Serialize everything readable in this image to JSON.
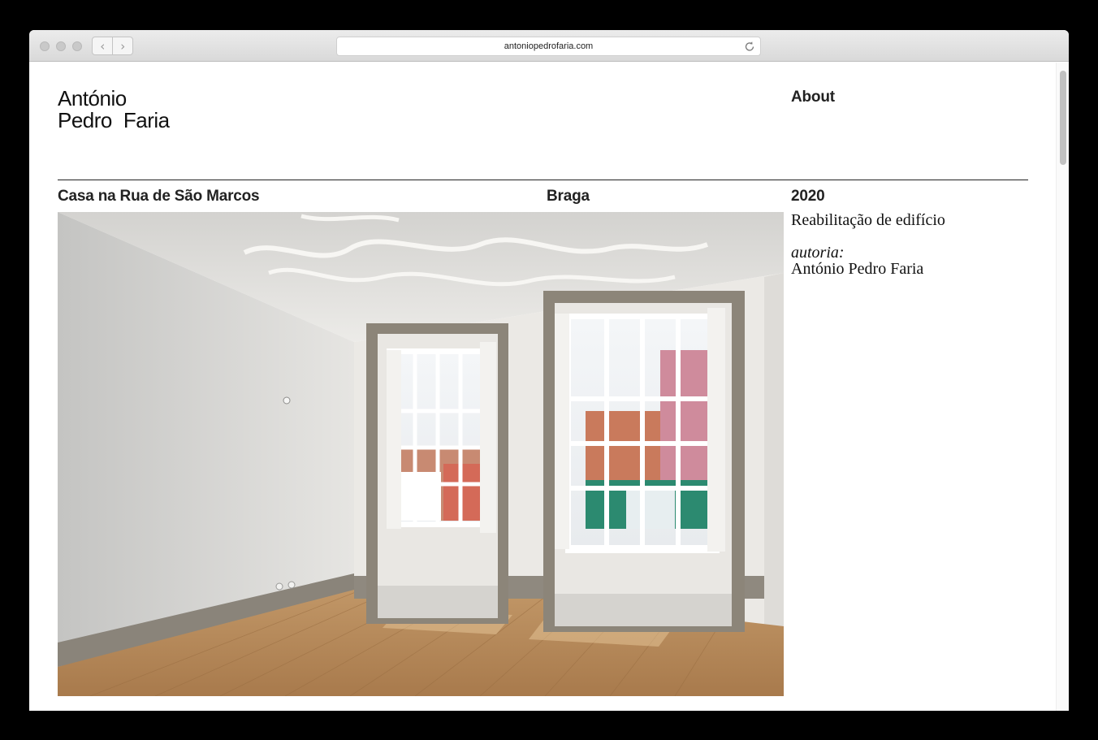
{
  "browser": {
    "url": "antoniopedrofaria.com",
    "back_glyph": "‹",
    "forward_glyph": "›"
  },
  "site": {
    "logo_line1": "António",
    "logo_word2": "Pedro",
    "logo_word3": "Faria",
    "nav_about": "About"
  },
  "project": {
    "title": "Casa na Rua de São Marcos",
    "city": "Braga",
    "year": "2020",
    "type": "Reabilitação de edifício",
    "author_label": "autoria:",
    "author": "António Pedro Faria"
  },
  "icons": [
    "reload-icon",
    "chevron-left-icon",
    "chevron-right-icon"
  ]
}
